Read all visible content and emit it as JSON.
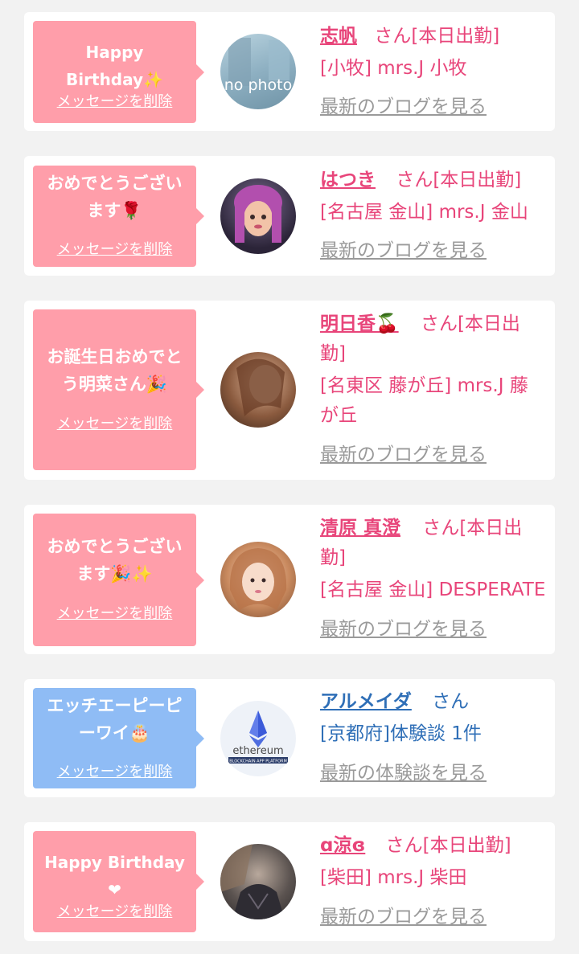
{
  "delete_label": "メッセージを削除",
  "entries": [
    {
      "message": "Happy Birthday✨",
      "name": "志帆",
      "suffix": "さん[本日出勤]",
      "shop": "[小牧] mrs.J 小牧",
      "link": "最新のブログを見る",
      "avatar_text": "no photo",
      "bubble_color": "#ff9eaa"
    },
    {
      "message": "おめでとうございます🌹",
      "name": "はつき",
      "suffix": "さん[本日出勤]",
      "shop": "[名古屋 金山] mrs.J 金山",
      "link": "最新のブログを見る",
      "bubble_color": "#ff9eaa"
    },
    {
      "message": "お誕生日おめでとう明菜さん🎉",
      "name": "明日香🍒",
      "suffix": "さん[本日出",
      "suffix2": "勤]",
      "shop": "[名東区 藤が丘] mrs.J 藤",
      "shop2": "が丘",
      "link": "最新のブログを見る",
      "bubble_color": "#ff9eaa"
    },
    {
      "message": "おめでとうございます🎉✨",
      "name": "清原 真澄",
      "suffix": "さん[本日出",
      "suffix2": "勤]",
      "shop": "[名古屋 金山] DESPERATE",
      "link": "最新のブログを見る",
      "bubble_color": "#ff9eaa"
    },
    {
      "message": "エッチエーピーピーワイ🎂",
      "name": "アルメイダ",
      "suffix": "さん",
      "shop": "[京都府]体験談 1件",
      "link": "最新の体験談を見る",
      "avatar_text": "ethereum",
      "avatar_subtext": "BLOCKCHAIN APP PLATFORM",
      "bubble_color": "#8fbcf5"
    },
    {
      "message": "Happy Birthday❤",
      "name": "ɑ涼ɞ",
      "suffix": "さん[本日出勤]",
      "shop": "[柴田] mrs.J 柴田",
      "link": "最新のブログを見る",
      "bubble_color": "#ff9eaa"
    }
  ]
}
